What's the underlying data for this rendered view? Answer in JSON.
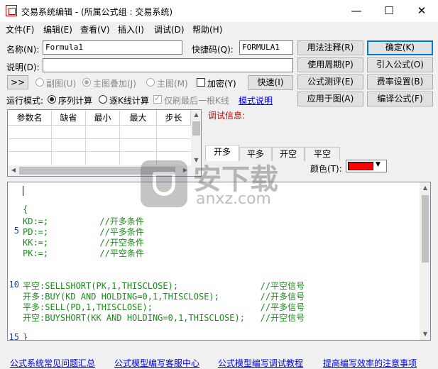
{
  "window": {
    "title": "交易系统编辑 - (所属公式组 : 交易系统)",
    "min": "—",
    "max": "☐",
    "close": "✕"
  },
  "menu": [
    "文件(F)",
    "编辑(E)",
    "查看(V)",
    "插入(I)",
    "调试(D)",
    "帮助(H)"
  ],
  "form": {
    "name_label": "名称(N):",
    "name_value": "Formula1",
    "shortcut_label": "快捷码(Q):",
    "shortcut_value": "FORMULA1",
    "desc_label": "说明(D):",
    "desc_value": "",
    "expand_label": ">>",
    "opt_subchart": "副图(U)",
    "opt_overlay": "主图叠加(J)",
    "opt_mainchart": "主图(M)",
    "opt_encrypt": "加密(Y)",
    "fast_button": "快速(I)",
    "run_mode_label": "运行模式:",
    "run_seq": "序列计算",
    "run_step": "逐K线计算",
    "last_only": "仅刷最后一根K线",
    "mode_help": "模式说明"
  },
  "buttons": {
    "syntax": "用法注释(R)",
    "ok": "确定(K)",
    "period": "使用周期(P)",
    "import": "引入公式(O)",
    "test": "公式测评(E)",
    "fee": "费率设置(B)",
    "apply": "应用于图(A)",
    "compile": "编译公式(F)"
  },
  "params": {
    "headers": [
      "参数名",
      "缺省",
      "最小",
      "最大",
      "步长"
    ]
  },
  "debug": {
    "label": "调试信息:"
  },
  "tabs": [
    "开多",
    "平多",
    "开空",
    "平空"
  ],
  "color": {
    "label": "颜色(T):",
    "value": "#ff0000"
  },
  "editor": {
    "line_numbers": [
      "5",
      "10",
      "15"
    ],
    "lines": [
      "",
      "",
      "{",
      "KD:=;          //开多条件",
      "PD:=;          //平多条件",
      "KK:=;          //开空条件",
      "PK:=;          //平空条件",
      "",
      "",
      "平空:SELLSHORT(PK,1,THISCLOSE);                //平空信号",
      "开多:BUY(KD AND HOLDING=0,1,THISCLOSE);        //开多信号",
      "平多:SELL(PD,1,THISCLOSE);                     //平多信号",
      "开空:BUYSHORT(KK AND HOLDING=0,1,THISCLOSE);   //开空信号",
      "",
      "",
      "}"
    ]
  },
  "footer": {
    "links": [
      "公式系统常见问题汇总",
      "公式模型编写客服中心",
      "公式模型编写调试教程",
      "提高编写效率的注意事项"
    ]
  },
  "watermark": {
    "line1": "安下载",
    "line2": "anxz.com"
  }
}
